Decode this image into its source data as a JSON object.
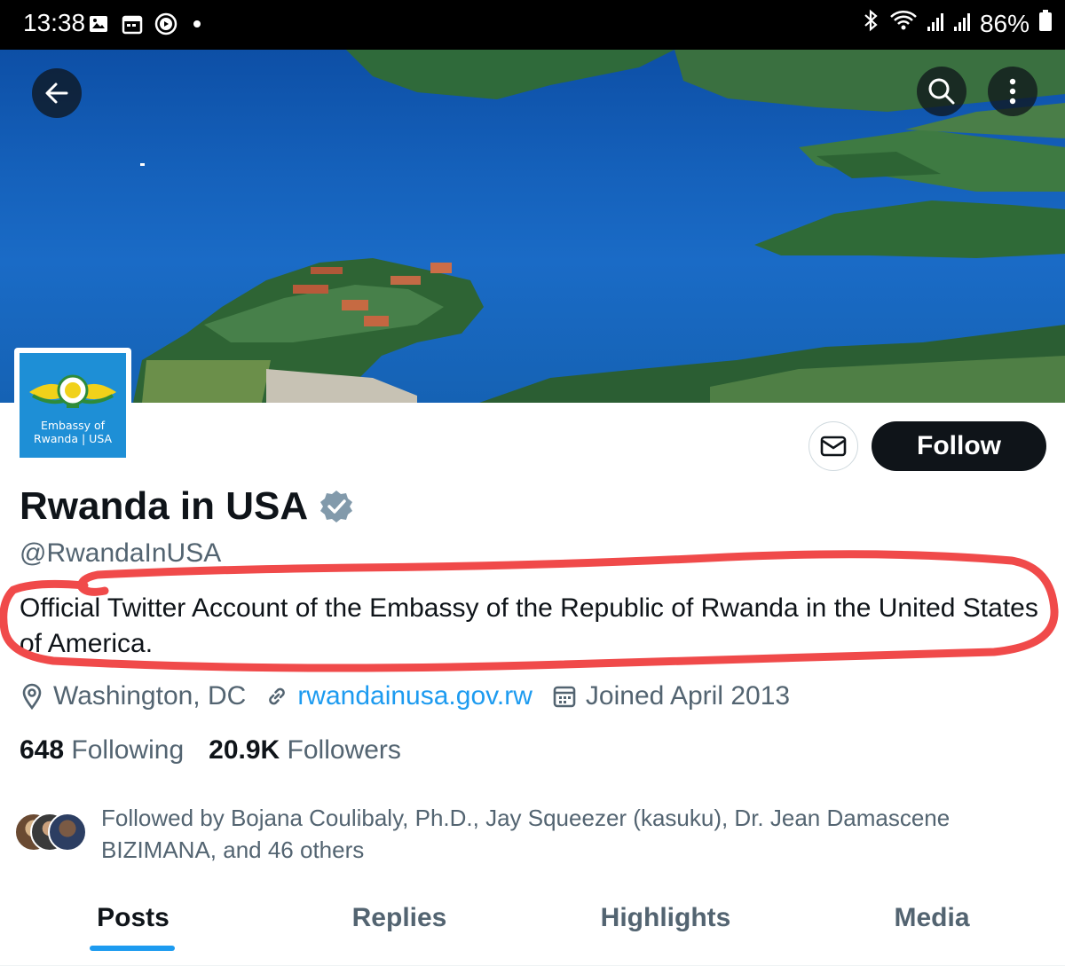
{
  "status_bar": {
    "time": "13:38",
    "battery": "86%"
  },
  "profile": {
    "avatar_text_line1": "Embassy of",
    "avatar_text_line2": "Rwanda | USA",
    "name": "Rwanda in USA",
    "verified": true,
    "handle": "@RwandaInUSA",
    "bio": "Official Twitter Account of the Embassy of the Republic of Rwanda in the United States of America.",
    "location": "Washington, DC",
    "website": "rwandainusa.gov.rw",
    "joined": "Joined April 2013",
    "following_count": "648",
    "following_label": "Following",
    "followers_count": "20.9K",
    "followers_label": "Followers",
    "followed_by": "Followed by Bojana Coulibaly, Ph.D., Jay Squeezer (kasuku), Dr. Jean Damascene BIZIMANA, and 46 others"
  },
  "actions": {
    "follow_label": "Follow"
  },
  "tabs": [
    {
      "label": "Posts",
      "active": true
    },
    {
      "label": "Replies",
      "active": false
    },
    {
      "label": "Highlights",
      "active": false
    },
    {
      "label": "Media",
      "active": false
    }
  ],
  "colors": {
    "accent": "#1d9bf0",
    "annotation": "#f04a4a",
    "text_secondary": "#536471"
  }
}
